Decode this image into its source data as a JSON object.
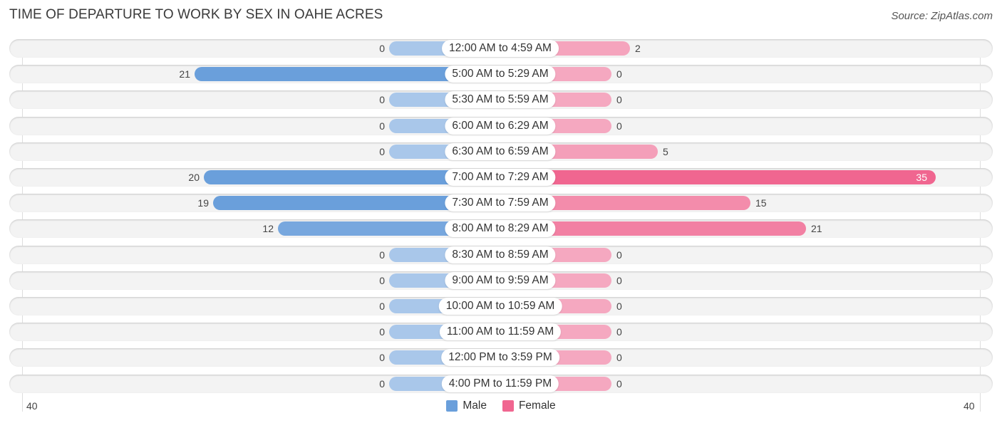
{
  "header": {
    "title": "TIME OF DEPARTURE TO WORK BY SEX IN OAHE ACRES",
    "source": "Source: ZipAtlas.com"
  },
  "colors": {
    "male": "#6a9fdb",
    "male_light": "#a9c7ea",
    "female": "#f06690",
    "female_light": "#f5a8c0"
  },
  "legend": [
    {
      "label": "Male",
      "color": "#6a9fdb"
    },
    {
      "label": "Female",
      "color": "#f06690"
    }
  ],
  "axis": {
    "left_label": "40",
    "right_label": "40"
  },
  "chart_data": {
    "type": "bar",
    "orientation": "horizontal-diverging",
    "title": "TIME OF DEPARTURE TO WORK BY SEX IN OAHE ACRES",
    "xlabel": "",
    "ylabel": "",
    "xlim": [
      -40,
      40
    ],
    "legend_position": "bottom-center",
    "categories": [
      "12:00 AM to 4:59 AM",
      "5:00 AM to 5:29 AM",
      "5:30 AM to 5:59 AM",
      "6:00 AM to 6:29 AM",
      "6:30 AM to 6:59 AM",
      "7:00 AM to 7:29 AM",
      "7:30 AM to 7:59 AM",
      "8:00 AM to 8:29 AM",
      "8:30 AM to 8:59 AM",
      "9:00 AM to 9:59 AM",
      "10:00 AM to 10:59 AM",
      "11:00 AM to 11:59 AM",
      "12:00 PM to 3:59 PM",
      "4:00 PM to 11:59 PM"
    ],
    "series": [
      {
        "name": "Male",
        "values": [
          0,
          21,
          0,
          0,
          0,
          20,
          19,
          12,
          0,
          0,
          0,
          0,
          0,
          0
        ]
      },
      {
        "name": "Female",
        "values": [
          2,
          0,
          0,
          0,
          5,
          35,
          15,
          21,
          0,
          0,
          0,
          0,
          0,
          0
        ]
      }
    ]
  }
}
